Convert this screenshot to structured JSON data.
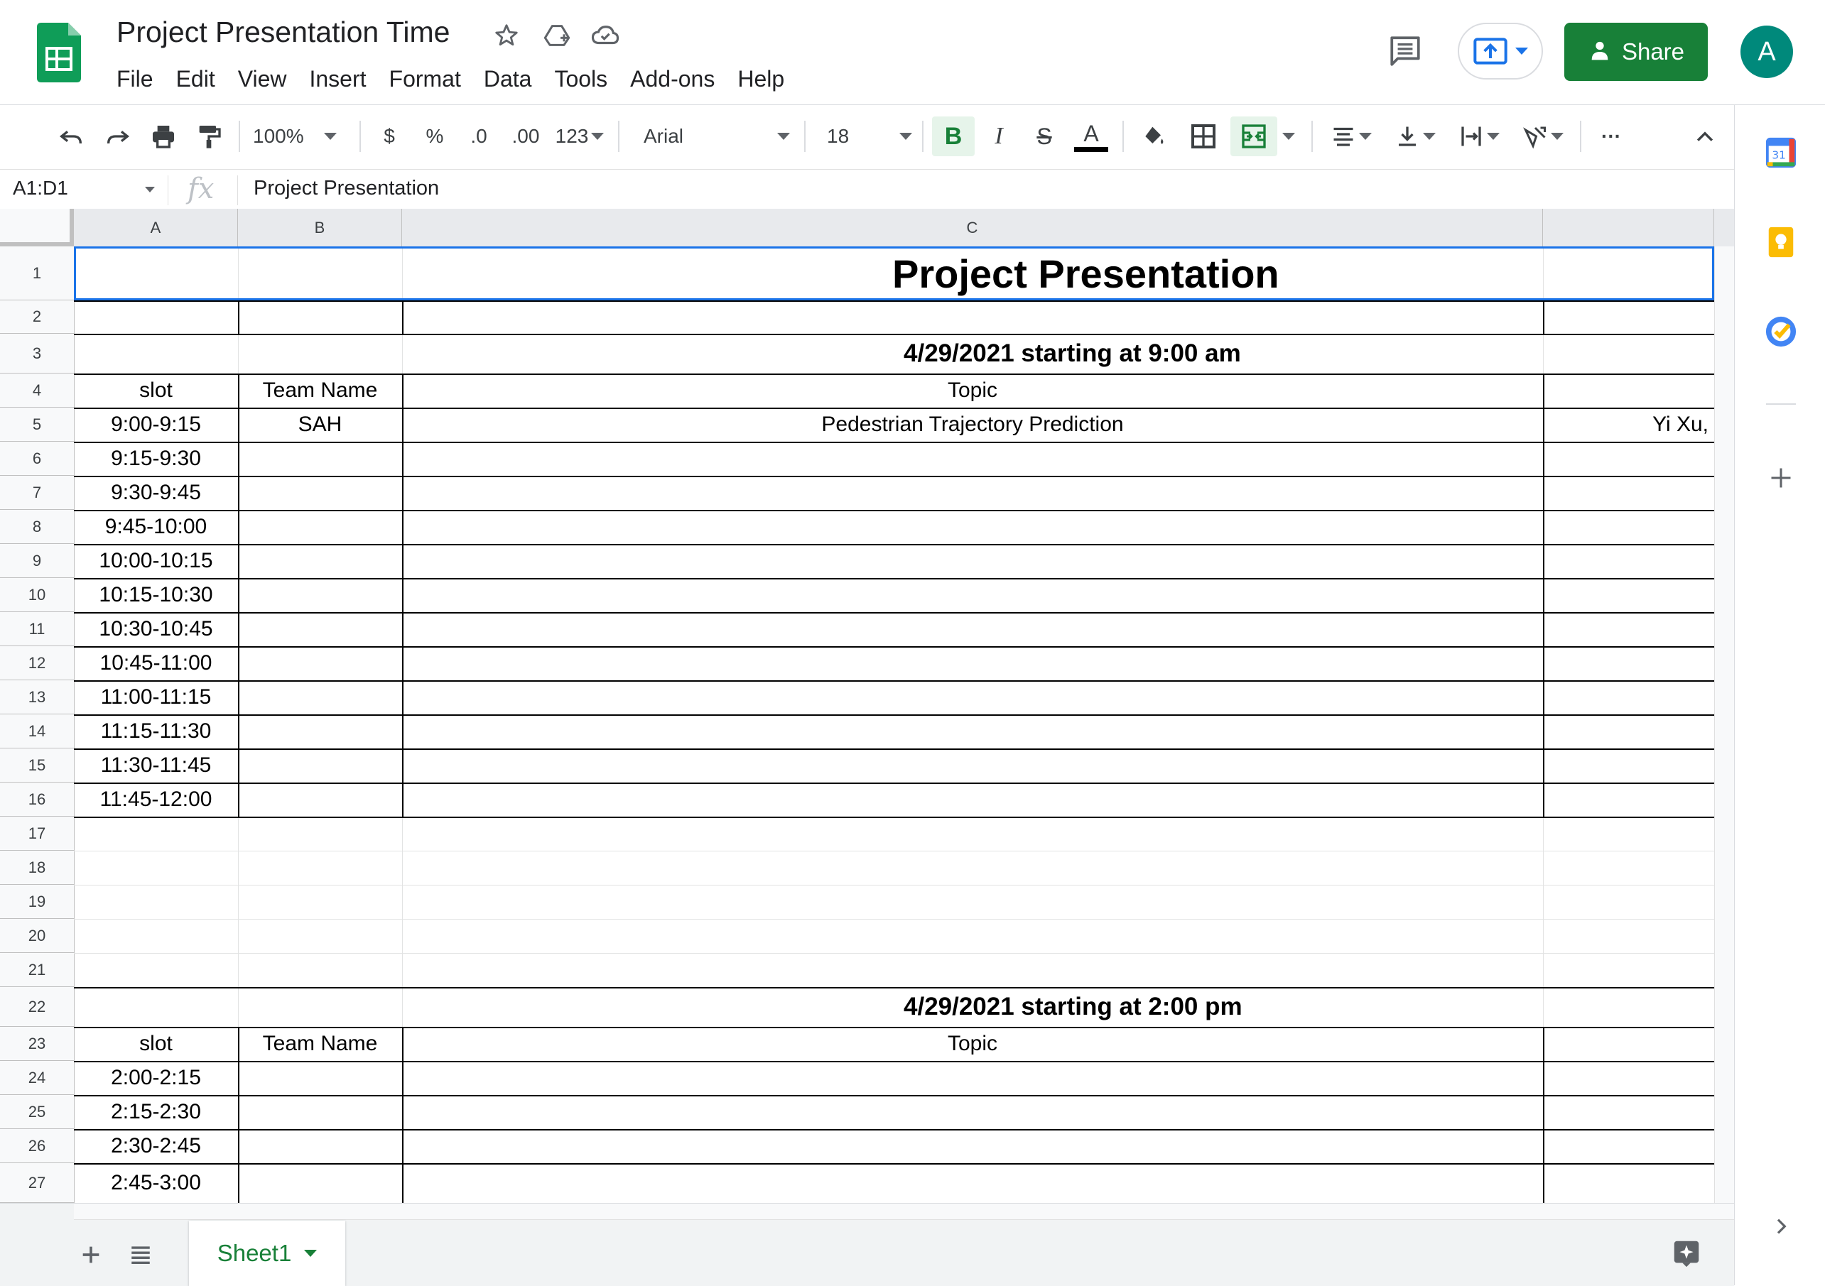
{
  "app": {
    "doc_title": "Project Presentation Time",
    "menu": [
      "File",
      "Edit",
      "View",
      "Insert",
      "Format",
      "Data",
      "Tools",
      "Add-ons",
      "Help"
    ],
    "share_label": "Share",
    "avatar_initial": "A",
    "accent_color": "#188038",
    "selection_color": "#1a73e8"
  },
  "toolbar": {
    "zoom": "100%",
    "currency": "$",
    "percent": "%",
    "decrease_decimal": ".0",
    "increase_decimal": ".00",
    "more_formats": "123",
    "font": "Arial",
    "font_size": "18",
    "bold": "B",
    "italic": "I",
    "strike": "S",
    "text_color": "A",
    "more": "···"
  },
  "formula_bar": {
    "name_box": "A1:D1",
    "fx": "fx",
    "content": "Project Presentation"
  },
  "sheet": {
    "columns": [
      "A",
      "B",
      "C"
    ],
    "rows": [
      "1",
      "2",
      "3",
      "4",
      "5",
      "6",
      "7",
      "8",
      "9",
      "10",
      "11",
      "12",
      "13",
      "14",
      "15",
      "16",
      "17",
      "18",
      "19",
      "20",
      "21",
      "22",
      "23",
      "24",
      "25",
      "26",
      "27"
    ],
    "title": "Project Presentation",
    "session1": {
      "header": "4/29/2021 starting at 9:00 am",
      "col_slot": "slot",
      "col_team": "Team Name",
      "col_topic": "Topic",
      "entries": [
        {
          "slot": "9:00-9:15",
          "team": "SAH",
          "topic": "Pedestrian Trajectory Prediction",
          "d": "Yi Xu,"
        },
        {
          "slot": "9:15-9:30",
          "team": "",
          "topic": "",
          "d": ""
        },
        {
          "slot": "9:30-9:45",
          "team": "",
          "topic": "",
          "d": ""
        },
        {
          "slot": "9:45-10:00",
          "team": "",
          "topic": "",
          "d": ""
        },
        {
          "slot": "10:00-10:15",
          "team": "",
          "topic": "",
          "d": ""
        },
        {
          "slot": "10:15-10:30",
          "team": "",
          "topic": "",
          "d": ""
        },
        {
          "slot": "10:30-10:45",
          "team": "",
          "topic": "",
          "d": ""
        },
        {
          "slot": "10:45-11:00",
          "team": "",
          "topic": "",
          "d": ""
        },
        {
          "slot": "11:00-11:15",
          "team": "",
          "topic": "",
          "d": ""
        },
        {
          "slot": "11:15-11:30",
          "team": "",
          "topic": "",
          "d": ""
        },
        {
          "slot": "11:30-11:45",
          "team": "",
          "topic": "",
          "d": ""
        },
        {
          "slot": "11:45-12:00",
          "team": "",
          "topic": "",
          "d": ""
        }
      ]
    },
    "session2": {
      "header": "4/29/2021 starting at 2:00 pm",
      "col_slot": "slot",
      "col_team": "Team Name",
      "col_topic": "Topic",
      "entries": [
        {
          "slot": "2:00-2:15"
        },
        {
          "slot": "2:15-2:30"
        },
        {
          "slot": "2:30-2:45"
        },
        {
          "slot": "2:45-3:00"
        }
      ]
    }
  },
  "tabs": {
    "active_sheet": "Sheet1"
  },
  "side_panel": {
    "calendar_day": "31"
  }
}
